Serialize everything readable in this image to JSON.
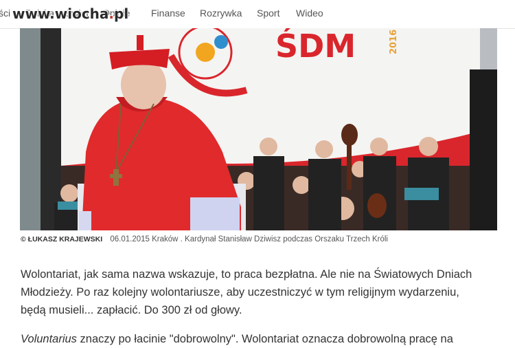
{
  "nav": {
    "items": [
      {
        "label": "ści"
      },
      {
        "label": "Polska"
      },
      {
        "label": "Świat"
      },
      {
        "label": "Opinie"
      },
      {
        "label": "Finanse"
      },
      {
        "label": "Rozrywka"
      },
      {
        "label": "Sport"
      },
      {
        "label": "Wideo"
      }
    ]
  },
  "watermark": {
    "text_main": "www.wiocha",
    "text_dot": ".",
    "text_end": "pl"
  },
  "photo": {
    "banner_text": "ŚDM",
    "banner_year": "2016"
  },
  "caption": {
    "credit": "© ŁUKASZ KRAJEWSKI",
    "text": "06.01.2015 Kraków . Kardynał Stanisław Dziwisz podczas Orszaku Trzech Króli"
  },
  "article": {
    "paragraph1": "Wolontariat, jak sama nazwa wskazuje, to praca bezpłatna. Ale nie na Światowych Dniach Młodzieży. Po raz kolejny wolontariusze, aby uczestniczyć w tym religijnym wydarzeniu, będą musieli... zapłacić. Do 300 zł od głowy.",
    "paragraph2_em": "Voluntarius",
    "paragraph2_rest": " znaczy po łacinie \"dobrowolny\". Wolontariat oznacza dobrowolną pracę na"
  }
}
